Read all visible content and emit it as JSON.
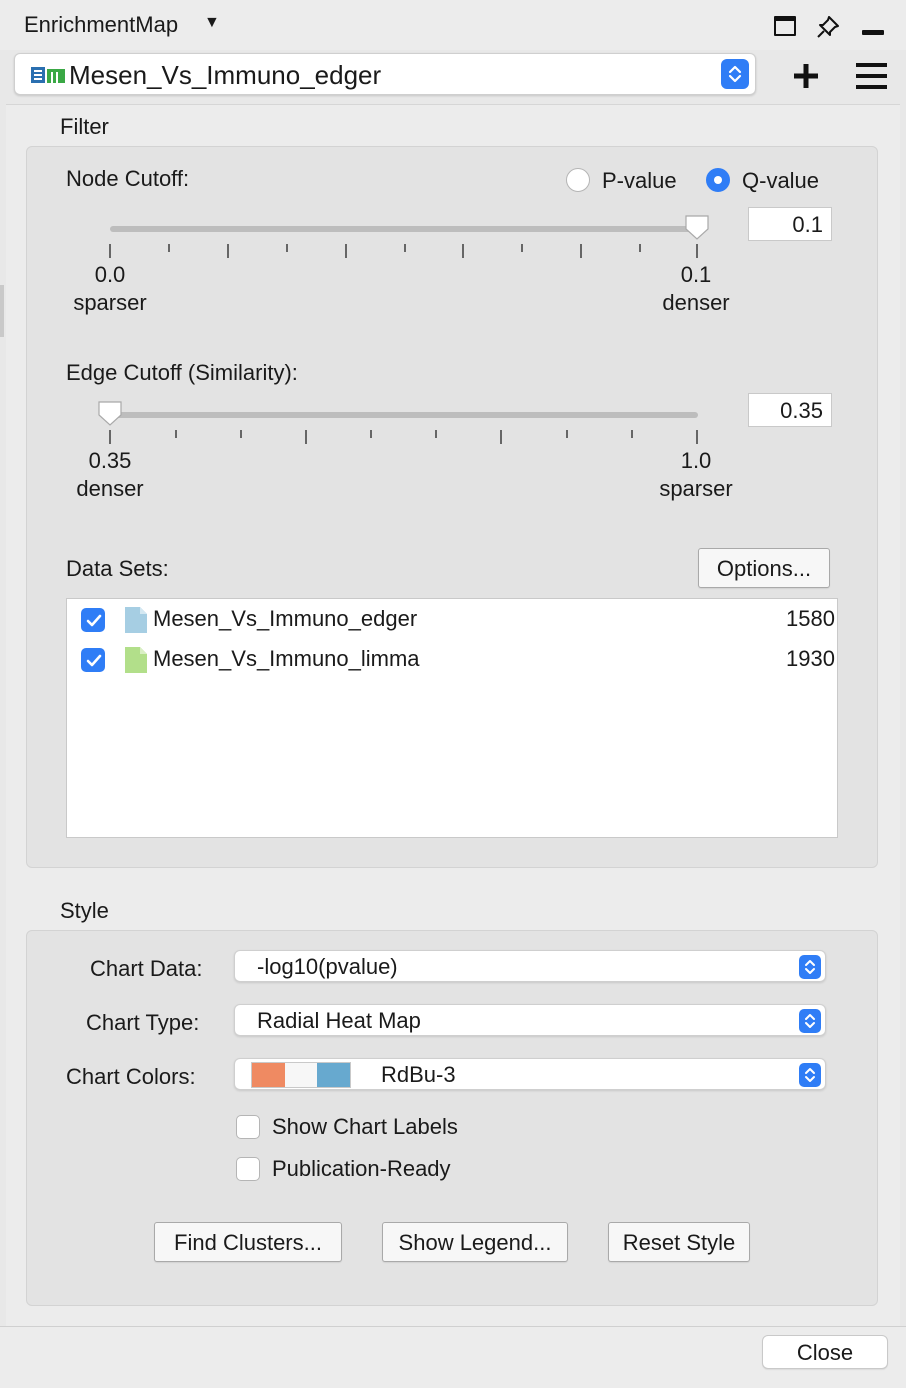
{
  "window": {
    "title": "EnrichmentMap",
    "title_menu_icon": "triangle-down-icon",
    "controls": [
      "float-window-icon",
      "pin-icon",
      "minimize-icon"
    ]
  },
  "network_selector": {
    "value": "Mesen_Vs_Immuno_edger",
    "icon": "enrichment-map-network-icon",
    "add_icon": "plus-icon",
    "menu_icon": "hamburger-menu-icon"
  },
  "filter": {
    "title": "Filter",
    "node_cutoff": {
      "label": "Node Cutoff:",
      "radio_options": [
        {
          "label": "P-value",
          "selected": false
        },
        {
          "label": "Q-value",
          "selected": true
        }
      ],
      "value": "0.1",
      "min_label": "0.0",
      "min_desc": "sparser",
      "max_label": "0.1",
      "max_desc": "denser",
      "slider_fraction": 1.0
    },
    "edge_cutoff": {
      "label": "Edge Cutoff (Similarity):",
      "value": "0.35",
      "min_label": "0.35",
      "min_desc": "denser",
      "max_label": "1.0",
      "max_desc": "sparser",
      "slider_fraction": 0.0
    },
    "data_sets": {
      "label": "Data Sets:",
      "options_button": "Options...",
      "items": [
        {
          "name": "Mesen_Vs_Immuno_edger",
          "count": "1580",
          "checked": true,
          "color": "#a6cee3"
        },
        {
          "name": "Mesen_Vs_Immuno_limma",
          "count": "1930",
          "checked": true,
          "color": "#b2df8a"
        }
      ]
    }
  },
  "style": {
    "title": "Style",
    "chart_data_label": "Chart Data:",
    "chart_data_value": "-log10(pvalue)",
    "chart_type_label": "Chart Type:",
    "chart_type_value": "Radial Heat Map",
    "chart_colors_label": "Chart Colors:",
    "chart_colors_value": "RdBu-3",
    "chart_colors_swatches": [
      "#ef8a62",
      "#f7f7f7",
      "#67a9cf"
    ],
    "show_chart_labels": {
      "label": "Show Chart Labels",
      "checked": false
    },
    "publication_ready": {
      "label": "Publication-Ready",
      "checked": false
    },
    "buttons": {
      "find_clusters": "Find Clusters...",
      "show_legend": "Show Legend...",
      "reset_style": "Reset Style"
    }
  },
  "footer": {
    "close_button": "Close"
  },
  "colors": {
    "accent": "#2f7df6"
  }
}
